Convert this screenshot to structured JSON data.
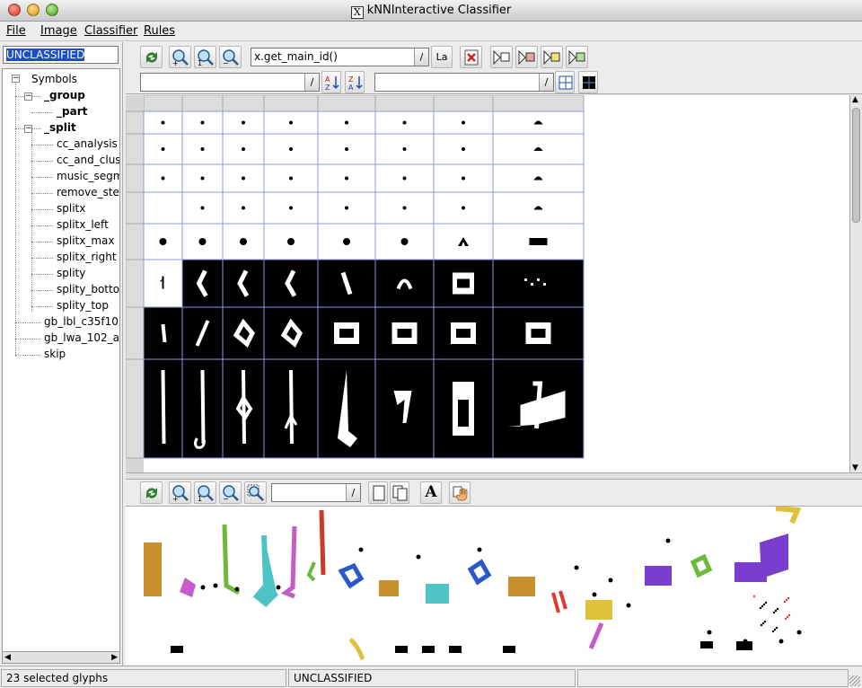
{
  "window": {
    "title": "kNNInteractive Classifier",
    "x_icon": "X"
  },
  "menu": [
    "File",
    "Image",
    "Classifier",
    "Rules"
  ],
  "menu_underline_index": [
    0,
    0,
    0,
    0
  ],
  "class_input": {
    "value": "UNCLASSIFIED"
  },
  "tree": {
    "root": "Symbols",
    "items": [
      {
        "label": "_group",
        "bold": true,
        "level": 1,
        "expander": "-"
      },
      {
        "label": "_part",
        "bold": true,
        "level": 2
      },
      {
        "label": "_split",
        "bold": true,
        "level": 1,
        "expander": "-"
      },
      {
        "label": "cc_analysis",
        "level": 2
      },
      {
        "label": "cc_and_clus",
        "level": 2
      },
      {
        "label": "music_segm",
        "level": 2
      },
      {
        "label": "remove_ster",
        "level": 2
      },
      {
        "label": "splitx",
        "level": 2
      },
      {
        "label": "splitx_left",
        "level": 2
      },
      {
        "label": "splitx_max",
        "level": 2
      },
      {
        "label": "splitx_right",
        "level": 2
      },
      {
        "label": "splity",
        "level": 2
      },
      {
        "label": "splity_botton",
        "level": 2
      },
      {
        "label": "splity_top",
        "level": 2
      },
      {
        "label": "gb_lbl_c35f10",
        "level": 1
      },
      {
        "label": "gb_lwa_102_a",
        "level": 1
      },
      {
        "label": "skip",
        "level": 1
      }
    ]
  },
  "toolbar_top": {
    "expression_value": "x.get_main_id()",
    "label_button": "La",
    "sort_field_value": "",
    "filter_field_value": "",
    "sort_asc_label": "A Z",
    "sort_desc_label": "Z A"
  },
  "toolbar_bottom": {
    "zoom_field_value": "",
    "text_button": "A"
  },
  "status": {
    "selected": "23 selected glyphs",
    "classification": "UNCLASSIFIED",
    "extra": ""
  },
  "icons": [
    "refresh-icon",
    "zoom-in-icon",
    "zoom-reset-icon",
    "zoom-out-icon",
    "delete-icon",
    "play-white-icon",
    "play-red-icon",
    "play-yellow-icon",
    "play-green-icon",
    "grid-icon",
    "checker-icon",
    "page-icon",
    "copy-icon",
    "text-icon",
    "hand-icon"
  ],
  "colors": {
    "selection": "#1a4ecb",
    "grid_line": "#9aa0e0",
    "glyph_palette": [
      "#c8902f",
      "#6fb93a",
      "#4ec3c6",
      "#c45cc9",
      "#c83a2a",
      "#2a57c9",
      "#e0c23a",
      "#7a3ecf",
      "#e03a30"
    ]
  }
}
